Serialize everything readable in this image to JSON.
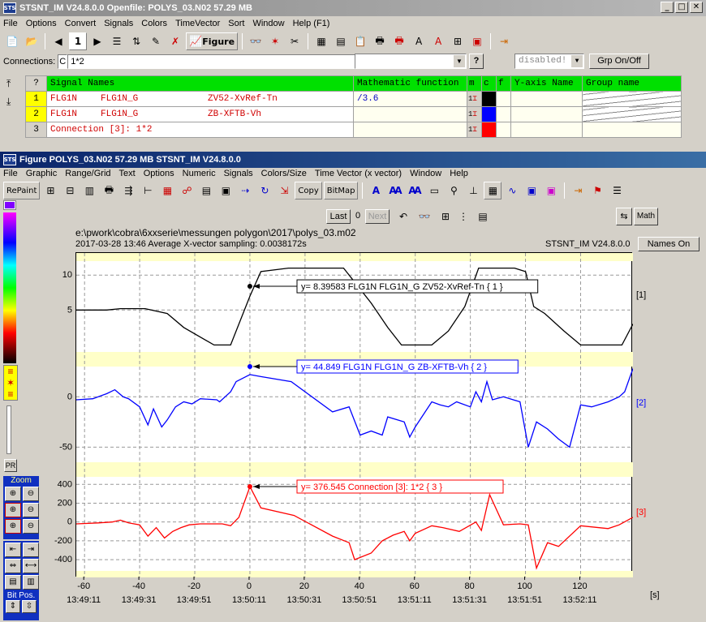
{
  "top_window": {
    "logo": "STS",
    "title": "STSNT_IM V24.8.0.0     Openfile: POLYS_03.N02  57.29 MB",
    "menu": [
      "File",
      "Options",
      "Convert",
      "Signals",
      "Colors",
      "TimeVector",
      "Sort",
      "Window",
      "Help (F1)"
    ],
    "toolbar": {
      "counter": "1",
      "figure_label": "Figure"
    },
    "connections_label": "Connections:",
    "connections_prefix": "C",
    "connections_value": "1*2",
    "help_btn": "?",
    "disabled_label": "disabled!",
    "grp_btn": "Grp On/Off"
  },
  "signal_table": {
    "headers": {
      "q": "?",
      "names": "Signal Names",
      "math": "Mathematic function",
      "m": "m",
      "c": "c",
      "f": "f",
      "yaxis": "Y-axis Name",
      "group": "Group name"
    },
    "rows": [
      {
        "num": "1",
        "n1": "FLG1N",
        "n2": "FLG1N_G",
        "n3": "ZV52-XvRef-Tn",
        "math": "/3.6",
        "m": "1",
        "color": "#000000"
      },
      {
        "num": "2",
        "n1": "FLG1N",
        "n2": "FLG1N_G",
        "n3": "ZB-XFTB-Vh",
        "math": "",
        "m": "1",
        "color": "#0000ff"
      },
      {
        "num": "3",
        "n1": "Connection [3]: 1*2",
        "n2": "",
        "n3": "",
        "math": "",
        "m": "1",
        "color": "#ff0000"
      }
    ]
  },
  "figure_window": {
    "logo": "STS",
    "title": "Figure POLYS_03.N02  57.29 MB   STSNT_IM V24.8.0.0",
    "menu": [
      "File",
      "Graphic",
      "Range/Grid",
      "Text",
      "Options",
      "Numeric",
      "Signals",
      "Colors/Size",
      "Time Vector (x vector)",
      "Window",
      "Help"
    ],
    "toolbar": {
      "repaint": "RePaint",
      "copy": "Copy",
      "bitmap": "BitMap"
    },
    "nav": {
      "last": "Last",
      "count": "0",
      "next": "Next",
      "math": "Math"
    },
    "names_on": "Names On",
    "file_path": "e:\\pwork\\cobra\\6xxserie\\messungen polygon\\2017\\polys_03.m02",
    "info_line": "2017-03-28 13:46     Average X-vector sampling: 0.0038172s",
    "version": "STSNT_IM V24.8.0.0",
    "side": {
      "pr": "PR",
      "zoom": "Zoom",
      "bitpos": "Bit Pos."
    }
  },
  "chart_data": {
    "type": "line",
    "xlabel": "[s]",
    "x_ticks": [
      -60,
      -40,
      -20,
      0,
      20,
      40,
      60,
      80,
      100,
      120
    ],
    "x_time_labels": [
      "13:49:11",
      "13:49:31",
      "13:49:51",
      "13:50:11",
      "13:50:31",
      "13:50:51",
      "13:51:11",
      "13:51:31",
      "13:51:51",
      "13:52:11"
    ],
    "xlim": [
      -63,
      139
    ],
    "panels": [
      {
        "label": "[1]",
        "color": "#000000",
        "ylim": [
          -1,
          12
        ],
        "yticks": [
          5,
          10
        ],
        "cursor": {
          "x": 0,
          "y": 8.39583,
          "text": "y= 8.39583    FLG1N FLG1N_G ZV52-XvRef-Tn { 1 }"
        },
        "x": [
          -63,
          -52,
          -47,
          -38,
          -30,
          -24,
          -13,
          -7,
          0,
          4,
          14,
          24,
          34,
          38,
          44,
          50,
          55,
          66,
          72,
          78,
          83,
          88,
          96,
          100,
          103,
          107,
          114,
          120,
          124,
          129,
          135,
          139
        ],
        "y": [
          5,
          5,
          5.2,
          5.2,
          4.5,
          2.5,
          0,
          0,
          7,
          10.5,
          11,
          11,
          11,
          9,
          6,
          2.5,
          0,
          0,
          2,
          5.5,
          11,
          11,
          11,
          10.5,
          5.5,
          4.5,
          2,
          0,
          0,
          0,
          0,
          3
        ]
      },
      {
        "label": "[2]",
        "color": "#0000ff",
        "ylim": [
          -65,
          30
        ],
        "yticks": [
          -50,
          0
        ],
        "cursor": {
          "x": 0,
          "y": 44.849,
          "text": "y= 44.849    FLG1N FLG1N_G ZB-XFTB-Vh { 2 }"
        },
        "x": [
          -63,
          -57,
          -52,
          -49,
          -46,
          -44,
          -40,
          -37,
          -35,
          -32,
          -30,
          -27,
          -24,
          -21,
          -18,
          -12,
          -11,
          -9,
          -7,
          -5,
          0,
          4,
          15,
          30,
          36,
          40,
          44,
          48,
          50,
          56,
          58,
          60,
          66,
          69,
          72,
          75,
          80,
          82,
          84,
          86,
          88,
          92,
          98,
          101,
          104,
          108,
          112,
          116,
          120,
          124,
          130,
          134,
          136,
          139
        ],
        "y": [
          -3,
          -2,
          3,
          7,
          0,
          -2,
          -10,
          -28,
          -12,
          -30,
          -23,
          -10,
          -5,
          -7,
          -2,
          -3,
          -5,
          0,
          5,
          15,
          22,
          20,
          15,
          -15,
          -10,
          -38,
          -34,
          -38,
          -20,
          -25,
          -40,
          -30,
          -5,
          -8,
          -10,
          -5,
          -10,
          5,
          -5,
          15,
          -3,
          0,
          -5,
          -50,
          -25,
          -32,
          -42,
          -50,
          -8,
          -10,
          -5,
          0,
          5,
          28
        ]
      },
      {
        "label": "[3]",
        "color": "#ff0000",
        "ylim": [
          -520,
          480
        ],
        "yticks": [
          -400,
          -200,
          0,
          200,
          400
        ],
        "cursor": {
          "x": 0,
          "y": 376.545,
          "text": "y= 376.545    Connection [3]: 1*2  { 3 }"
        },
        "x": [
          -63,
          -55,
          -50,
          -47,
          -44,
          -40,
          -37,
          -34,
          -31,
          -28,
          -25,
          -22,
          -18,
          -10,
          -7,
          -4,
          0,
          4,
          16,
          30,
          36,
          38,
          44,
          48,
          52,
          56,
          58,
          60,
          66,
          70,
          76,
          82,
          84,
          87,
          92,
          98,
          101,
          104,
          108,
          112,
          120,
          130,
          134,
          139
        ],
        "y": [
          -20,
          -10,
          0,
          20,
          -10,
          -30,
          -150,
          -60,
          -170,
          -100,
          -60,
          -30,
          -20,
          -20,
          -40,
          50,
          376,
          150,
          70,
          -150,
          -220,
          -400,
          -330,
          -200,
          -140,
          -100,
          -200,
          -120,
          -40,
          -60,
          -100,
          0,
          -90,
          290,
          -30,
          -20,
          -30,
          -490,
          -220,
          -260,
          -40,
          -70,
          -30,
          50
        ]
      }
    ]
  }
}
